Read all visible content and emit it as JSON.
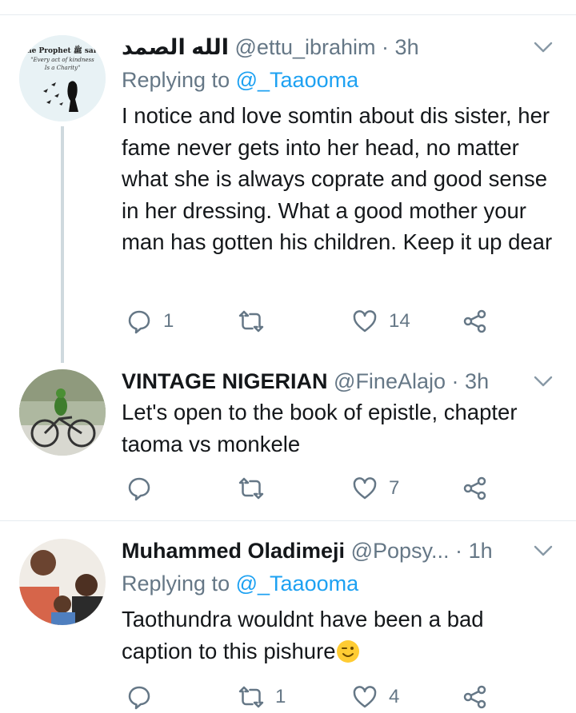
{
  "tweets": [
    {
      "display_name": "الله الصمد",
      "handle": "@ettu_ibrahim",
      "time": "3h",
      "replying_label": "Replying to",
      "replying_to": "@_Taaooma",
      "text": "I notice and love somtin about dis sister, her fame never gets into her head, no matter what she is always coprate and good sense in her dressing. What a good mother your man has gotten his children. Keep it up dear",
      "avatar_text": {
        "line1": "The Prophet ﷺ said,",
        "line2": "\"Every act of kindness",
        "line3": "Is a Charity\""
      },
      "replies": "1",
      "retweets": "",
      "likes": "14"
    },
    {
      "display_name": "VINTAGE NIGERIAN",
      "handle": "@FineAlajo",
      "time": "3h",
      "text": "Let's open to the book of epistle, chapter taoma vs monkele",
      "replies": "",
      "retweets": "",
      "likes": "7"
    },
    {
      "display_name": "Muhammed Oladimeji",
      "handle": "@Popsy...",
      "time": "1h",
      "replying_label": "Replying to",
      "replying_to": "@_Taaooma",
      "text": "Taothundra wouldnt have been a bad caption to this pishure",
      "replies": "",
      "retweets": "1",
      "likes": "4"
    }
  ],
  "colors": {
    "secondary": "#657786",
    "link": "#1da1f2",
    "divider": "#e6ecf0",
    "thread_line": "#cfd9de"
  },
  "icons": [
    "reply-icon",
    "retweet-icon",
    "like-icon",
    "share-icon",
    "chevron-down-icon",
    "wink-emoji"
  ]
}
